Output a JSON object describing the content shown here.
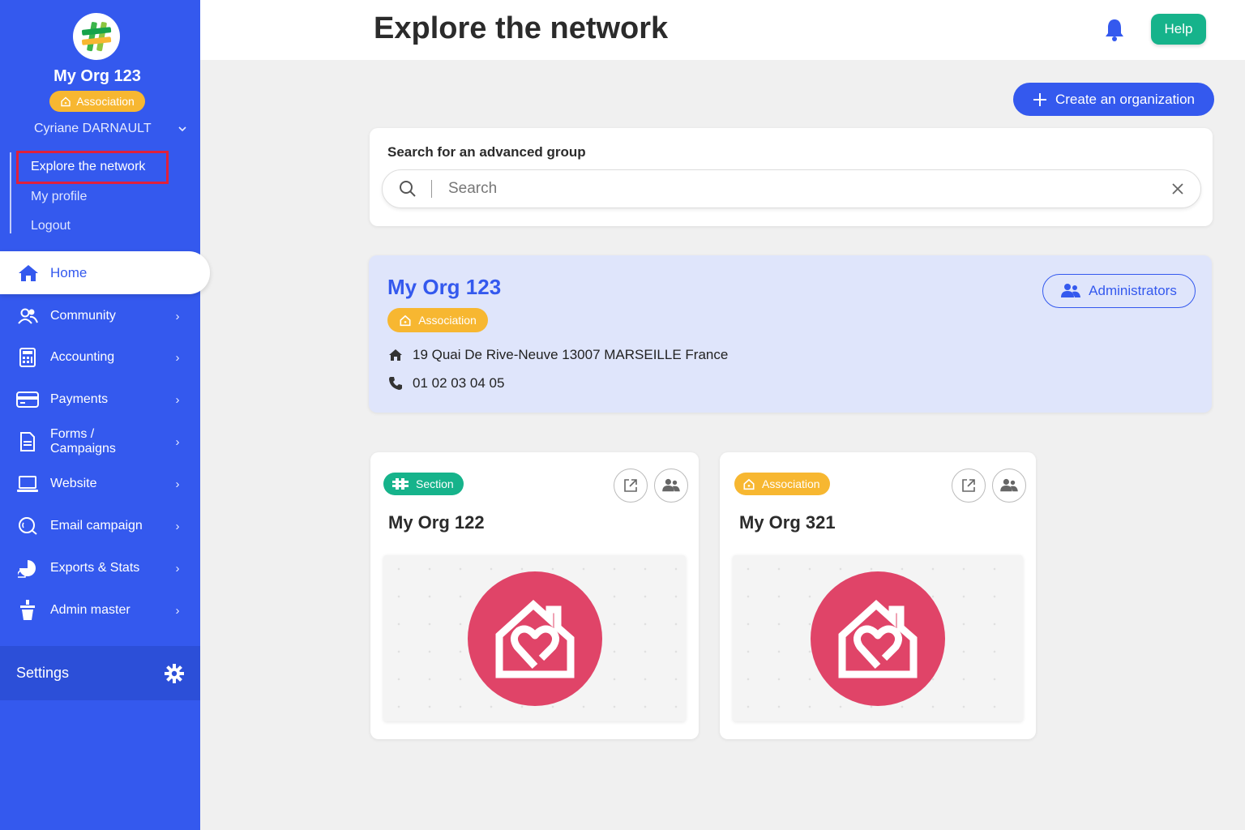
{
  "sidebar": {
    "org_name": "My Org 123",
    "org_badge": "Association",
    "user_name": "Cyriane DARNAULT",
    "user_links": [
      "Explore the network",
      "My profile",
      "Logout"
    ],
    "home_label": "Home",
    "menu": [
      "Community",
      "Accounting",
      "Payments",
      "Forms / Campaigns",
      "Website",
      "Email campaign",
      "Exports & Stats",
      "Admin master"
    ],
    "settings_label": "Settings"
  },
  "header": {
    "title": "Explore the network",
    "help_label": "Help"
  },
  "create_org_label": "Create an organization",
  "search": {
    "title": "Search for an advanced group",
    "placeholder": "Search"
  },
  "org_card": {
    "name": "My Org 123",
    "badge": "Association",
    "address": "19 Quai De Rive-Neuve 13007 MARSEILLE France",
    "phone": "01 02 03 04 05",
    "admin_label": "Administrators"
  },
  "children": [
    {
      "badge": "Section",
      "name": "My Org 122"
    },
    {
      "badge": "Association",
      "name": "My Org 321"
    }
  ],
  "colors": {
    "primary": "#3459ee",
    "association": "#f7b731",
    "section": "#16b38b",
    "help": "#16b38b",
    "logo_red": "#e04468",
    "highlight": "#e0203b"
  }
}
